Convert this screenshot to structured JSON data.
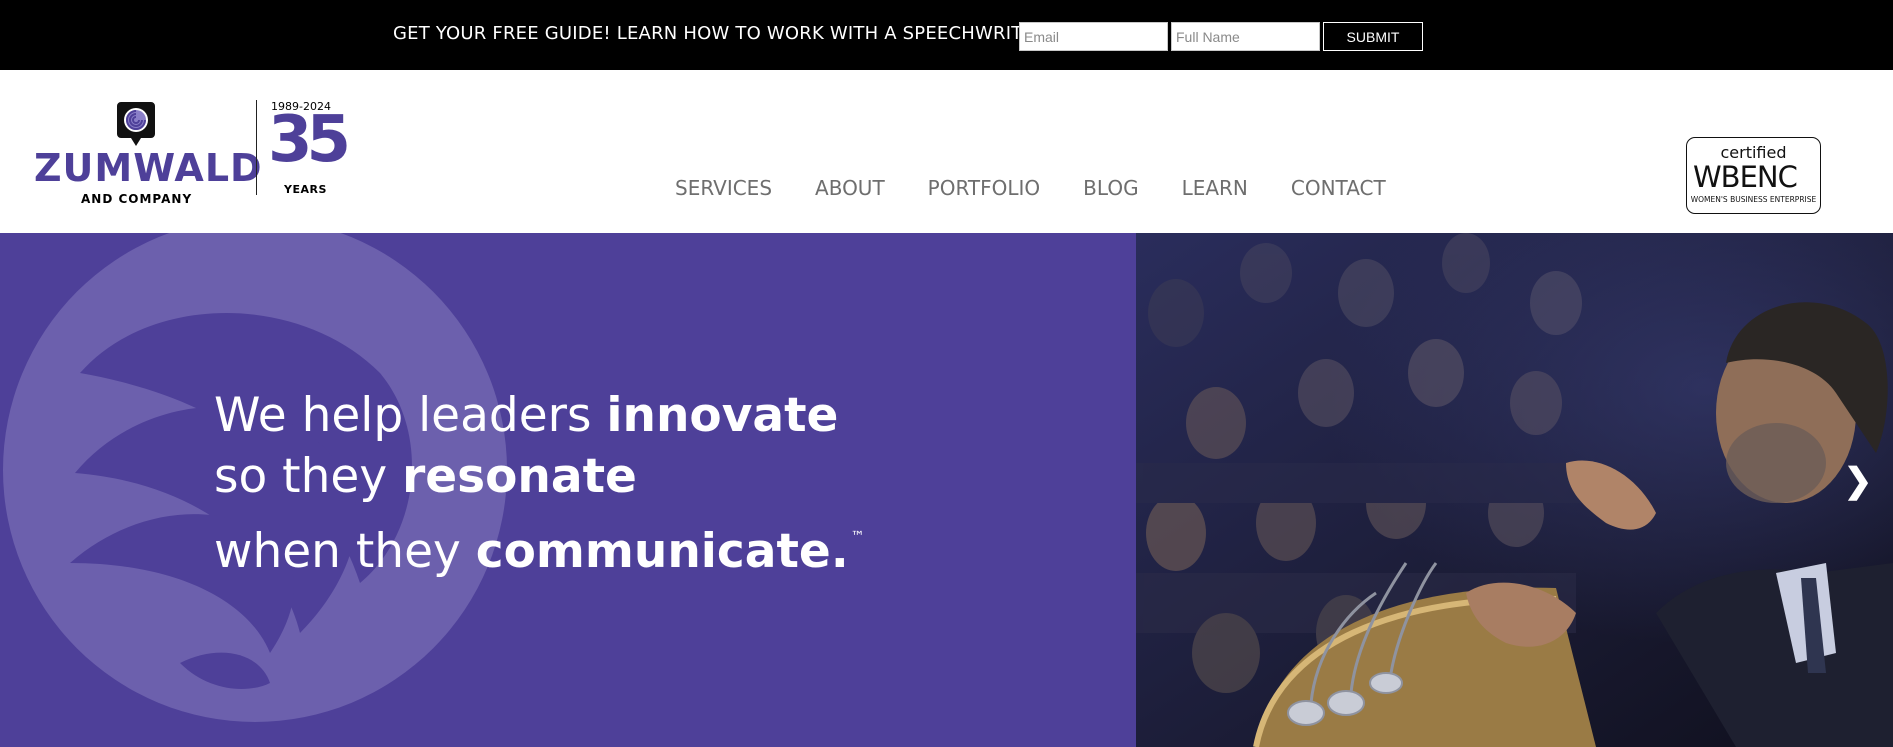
{
  "promo": {
    "text": "GET YOUR FREE GUIDE! LEARN HOW TO WORK WITH A SPEECHWRITER",
    "email_placeholder": "Email",
    "name_placeholder": "Full Name",
    "submit_label": "SUBMIT"
  },
  "logo": {
    "wordmark": "ZUMWALD",
    "subtitle": "AND COMPANY",
    "year_range": "1989-2024",
    "anniversary": "35",
    "anniversary_label": "YEARS"
  },
  "nav": {
    "items": [
      "SERVICES",
      "ABOUT",
      "PORTFOLIO",
      "BLOG",
      "LEARN",
      "CONTACT"
    ]
  },
  "badge": {
    "certified": "certified",
    "name": "WBENC",
    "subtitle": "WOMEN'S BUSINESS ENTERPRISE"
  },
  "hero": {
    "line1_plain": "We help leaders ",
    "line1_bold": "innovate",
    "line2_plain": "so they ",
    "line2_bold": "resonate",
    "line3_plain": "when they ",
    "line3_bold": "communicate.",
    "trademark": "™",
    "next_icon": "chevron-right-icon"
  },
  "colors": {
    "brand_purple": "#4e4099",
    "promo_bg": "#000000",
    "nav_text": "#6e6e6e"
  }
}
